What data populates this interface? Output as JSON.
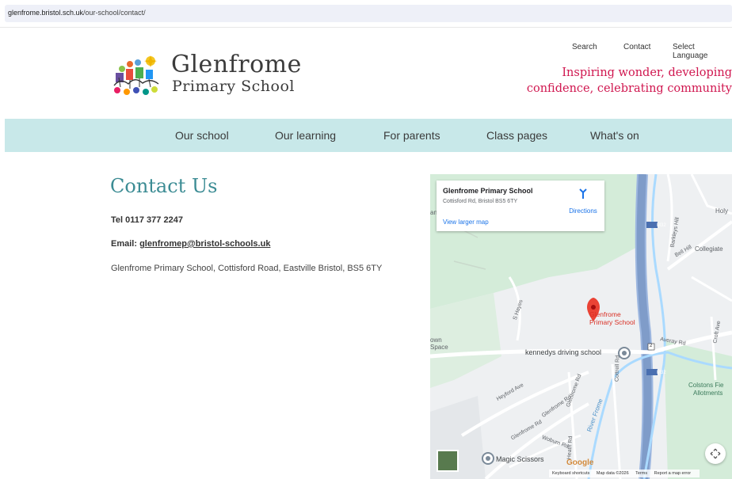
{
  "browser": {
    "url_host": "glenfrome.bristol.sch.uk",
    "url_path": "/our-school/contact/"
  },
  "header": {
    "logo_line1": "Glenfrome",
    "logo_line2": "Primary School",
    "links": {
      "search": "Search",
      "contact": "Contact",
      "language": "Select Language"
    },
    "tagline_line1": "Inspiring wonder, developing",
    "tagline_line2": "confidence, celebrating community",
    "tagline_color": "#d0164f"
  },
  "nav": {
    "bg_color": "#c8e8e9",
    "items": [
      "Our school",
      "Our learning",
      "For parents",
      "Class pages",
      "What's on"
    ]
  },
  "content": {
    "heading": "Contact Us",
    "tel": "Tel 0117 377 2247",
    "email_label": "Email: ",
    "email_value": "glenfromep@bristol-schools.uk",
    "address": "Glenfrome Primary School, Cottisford Road, Eastville Bristol, BS5 6TY",
    "heading_color": "#3c8c94"
  },
  "map": {
    "card_title": "Glenfrome Primary School",
    "card_address": "Cottisford Rd, Bristol BS5 6TY",
    "card_link": "View larger map",
    "directions": "Directions",
    "pin_label_line1": "Glenfrome",
    "pin_label_line2": "Primary School",
    "poi_driving": "kennedys driving school",
    "poi_scissors": "Magic Scissors",
    "labels": {
      "holy": "Holy",
      "collegiate": "Collegiate",
      "own": "own",
      "space": "Space",
      "s_hayes": "S Hayes",
      "barkleys_hill": "Barkleys Hill",
      "bell_hill": "Bell Hill",
      "averay_rd": "Averay Rd",
      "croft_ave": "Croft Ave",
      "colstons_fie": "Colstons Fie",
      "allotments": "Allotments",
      "heyford_ave": "Heyford Ave",
      "glenfrome_rd": "Glenfrome Rd",
      "glenfrome_rd_2": "Glenfrome Rd",
      "woburn_rd": "Woburn Rd",
      "cottrell_rd": "Cottrell Rd",
      "river_frome": "River Frome",
      "heath_rd": "Heath Rd",
      "m32_a": "M32",
      "m32_b": "M32",
      "road_2": "2",
      "an": "an"
    },
    "google": "Google",
    "footer": [
      "Keyboard shortcuts",
      "Map data ©2026",
      "Terms",
      "Report a map error"
    ]
  }
}
